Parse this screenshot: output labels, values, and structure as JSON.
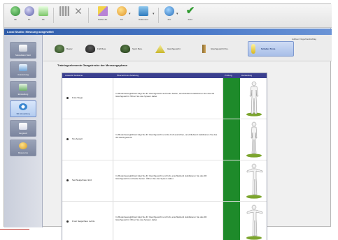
{
  "toolbar": {
    "buttons": [
      {
        "label": "Ok",
        "icon": "globe-icon"
      },
      {
        "label": "Dr.",
        "icon": "magnifier-icon"
      },
      {
        "label": "Ab.",
        "icon": "figure-icon"
      },
      {
        "label": "",
        "icon": "grid-icon"
      },
      {
        "label": "",
        "icon": "close-icon"
      },
      {
        "label": "Fehler Ab.",
        "icon": "pencil-icon"
      },
      {
        "label": "Ab.",
        "icon": "arrow-icon"
      },
      {
        "label": "Dokument",
        "icon": "document-icon"
      },
      {
        "label": "Pro",
        "icon": "person-icon"
      },
      {
        "label": "Fehl.",
        "icon": "check-icon"
      }
    ]
  },
  "titlebar": {
    "text": "Local Studio: Messung ausgewählt"
  },
  "sidebar": {
    "items": [
      {
        "label": "Messdaten Start",
        "icon": "start-icon"
      },
      {
        "label": "Auswertung",
        "icon": "chart-icon"
      },
      {
        "label": "Einstellung",
        "icon": "settings-icon"
      },
      {
        "label": "3D Einstellung",
        "icon": "rotate-icon"
      },
      {
        "label": "Vergleich",
        "icon": "compare-icon"
      },
      {
        "label": "Ressource",
        "icon": "resource-icon"
      }
    ]
  },
  "tabs": [
    {
      "label": "Bester",
      "icon": "foot-icon"
    },
    {
      "label": "Fuß Bew.",
      "icon": "foot-icon"
    },
    {
      "label": "Sport Bew.",
      "icon": "foot-icon"
    },
    {
      "label": "Gleichgewicht",
      "icon": "balance-icon"
    },
    {
      "label": "Gleichgewicht Pos.",
      "icon": "ruler-icon"
    },
    {
      "label": "Schulter Tests",
      "icon": "person-icon"
    }
  ],
  "subtitle_right": "Aufbau: Fingerhandschlag",
  "section_title": "Trainingselemente Gangstrecke der Messungsphase",
  "table": {
    "headers": [
      "Auswahl Testname",
      "Übersicht der Anleitung",
      "Prüfung",
      "Darstellung"
    ],
    "rows": [
      {
        "name": "Fuss Stegs",
        "desc": "Im Bodenbeweglichkeit trägt Sie Ihr Gleichgewicht auf beide Seiten, anschließend stabilisieren Sie das 3D Gleichgewicht. Öffnen Sie das System dabei."
      },
      {
        "name": "Ton Anstell",
        "desc": "Im Bodenbeweglichkeit trägt Sie Ihr Gleichgewicht und die Fuß ausrichten, anschließend stabilisieren Sie das 3D Gleichgewicht."
      },
      {
        "name": "Seit Neigschaw. linkz",
        "desc": "Im Bodenbeweglichkeit trägt Sie Ihr Gleichgewicht und Fuß, anschließend stabilisieren Sie das 3D Gleichgewicht und beide Seiten. Öffnen Sie das System dabei."
      },
      {
        "name": "Front Neigschaw. rechts",
        "desc": "Im Bodenbeweglichkeit trägt Sie Ihr Gleichgewicht und Fuß, anschließend stabilisieren Sie das 3D Gleichgewicht. Öffnen Sie das System dabei."
      }
    ]
  },
  "colors": {
    "titlebar": "#2e5ba8",
    "table_header": "#3a3f8f",
    "status_green": "#1e8a2a",
    "active_tab": "#b3ccf0"
  }
}
